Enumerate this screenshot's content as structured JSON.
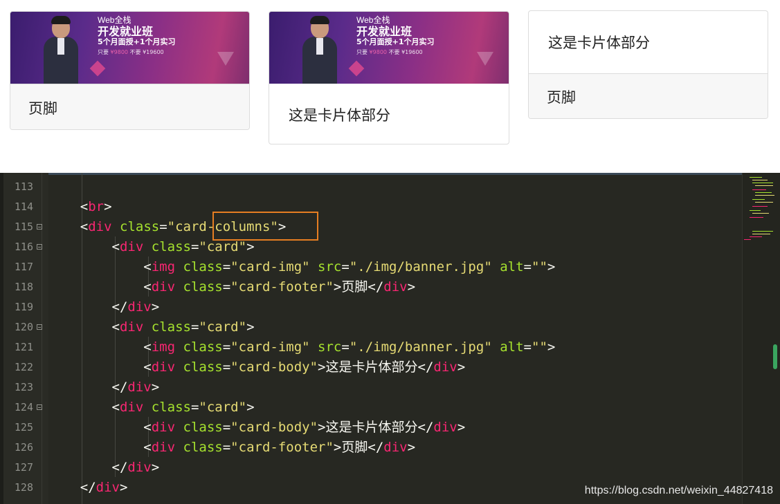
{
  "preview": {
    "banner": {
      "line1": "Web全栈",
      "line2": "开发就业班",
      "line3": "5个月面授+1个月实习",
      "line4_prefix": "只要",
      "price": "¥9800",
      "line4_suffix": "不要 ¥19600"
    },
    "cards": [
      {
        "footer": "页脚"
      },
      {
        "body": "这是卡片体部分"
      },
      {
        "body": "这是卡片体部分",
        "footer": "页脚"
      }
    ]
  },
  "editor": {
    "lines": [
      {
        "num": "113"
      },
      {
        "num": "114"
      },
      {
        "num": "115"
      },
      {
        "num": "116"
      },
      {
        "num": "117"
      },
      {
        "num": "118"
      },
      {
        "num": "119"
      },
      {
        "num": "120"
      },
      {
        "num": "121"
      },
      {
        "num": "122"
      },
      {
        "num": "123"
      },
      {
        "num": "124"
      },
      {
        "num": "125"
      },
      {
        "num": "126"
      },
      {
        "num": "127"
      },
      {
        "num": "128"
      }
    ],
    "strings": {
      "br": "br",
      "div": "div",
      "img": "img",
      "class": "class",
      "src": "src",
      "alt": "alt",
      "card_columns": "card-columns",
      "card": "card",
      "card_img": "card-img",
      "card_footer": "card-footer",
      "card_body": "card-body",
      "banner_path": "./img/banner.jpg",
      "footer_text": "页脚",
      "body_text": "这是卡片体部分"
    },
    "syntax_colors": {
      "background": "#272822",
      "tag": "#f92672",
      "attribute": "#a6e22e",
      "string": "#e6db74",
      "highlight_box": "#e67e22"
    }
  },
  "watermark": "https://blog.csdn.net/weixin_44827418"
}
